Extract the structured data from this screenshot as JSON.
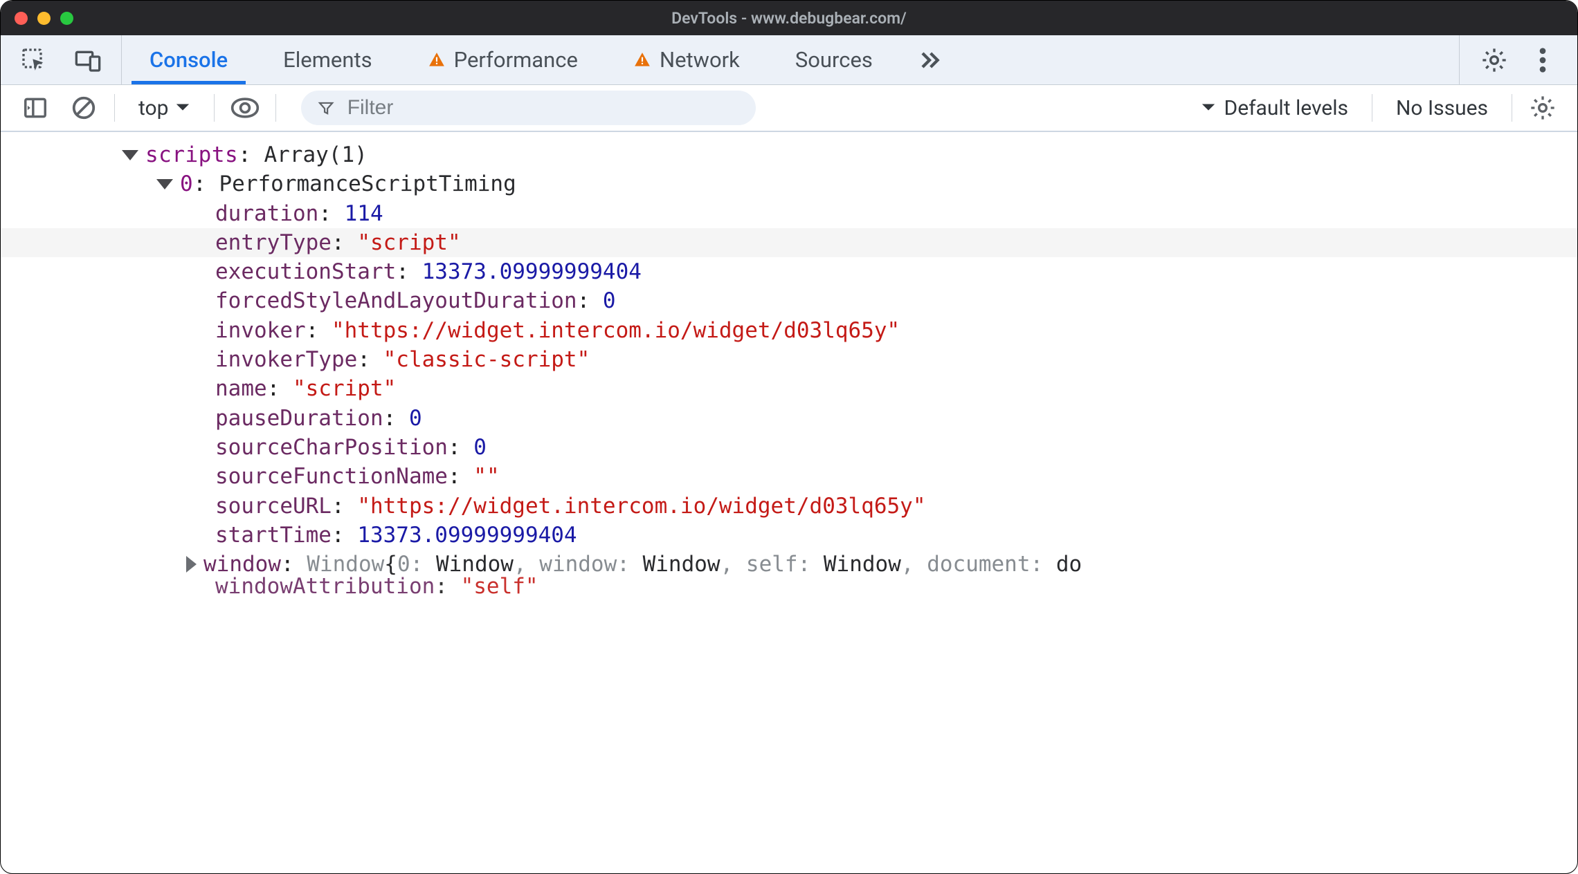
{
  "titlebar": {
    "title": "DevTools - www.debugbear.com/"
  },
  "tabs": {
    "console": "Console",
    "elements": "Elements",
    "performance": "Performance",
    "network": "Network",
    "sources": "Sources"
  },
  "toolbar": {
    "context": "top",
    "filter_placeholder": "Filter",
    "levels": "Default levels",
    "issues": "No Issues"
  },
  "console": {
    "scripts_key": "scripts",
    "scripts_type": "Array(1)",
    "idx_key": "0",
    "idx_type": "PerformanceScriptTiming",
    "props": {
      "duration_k": "duration",
      "duration_v": "114",
      "entryType_k": "entryType",
      "entryType_v": "\"script\"",
      "executionStart_k": "executionStart",
      "executionStart_v": "13373.09999999404",
      "forced_k": "forcedStyleAndLayoutDuration",
      "forced_v": "0",
      "invoker_k": "invoker",
      "invoker_v": "\"https://widget.intercom.io/widget/d03lq65y\"",
      "invokerType_k": "invokerType",
      "invokerType_v": "\"classic-script\"",
      "name_k": "name",
      "name_v": "\"script\"",
      "pauseDuration_k": "pauseDuration",
      "pauseDuration_v": "0",
      "sourceCharPosition_k": "sourceCharPosition",
      "sourceCharPosition_v": "0",
      "sourceFunctionName_k": "sourceFunctionName",
      "sourceFunctionName_v": "\"\"",
      "sourceURL_k": "sourceURL",
      "sourceURL_v": "\"https://widget.intercom.io/widget/d03lq65y\"",
      "startTime_k": "startTime",
      "startTime_v": "13373.09999999404"
    },
    "window_k": "window",
    "window_preview": {
      "type": "Window ",
      "open": "{",
      "k0": "0",
      "v0": "Window",
      "k1": "window",
      "v1": "Window",
      "k2": "self",
      "v2": "Window",
      "k3": "document",
      "v3": "do"
    },
    "cutoff_key": "windowAttribution",
    "cutoff_val": "\"self\""
  }
}
